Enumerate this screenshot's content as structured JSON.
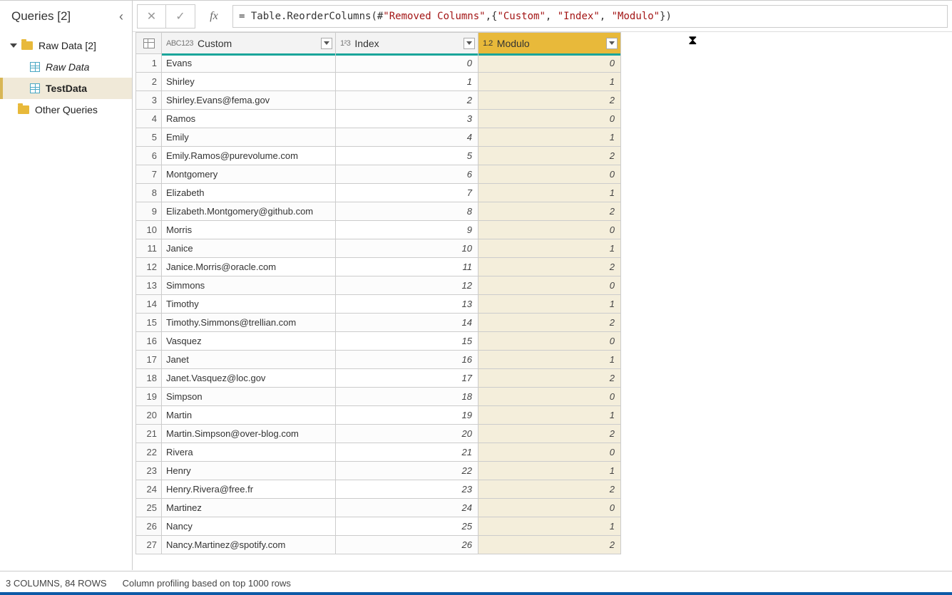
{
  "sidebar": {
    "title": "Queries [2]",
    "folders": [
      {
        "label": "Raw Data [2]",
        "expanded": true,
        "items": [
          {
            "label": "Raw Data",
            "italic": true,
            "selected": false
          },
          {
            "label": "TestData",
            "italic": false,
            "selected": true
          }
        ]
      },
      {
        "label": "Other Queries",
        "expanded": false,
        "items": []
      }
    ]
  },
  "formula": {
    "prefix": "= ",
    "func": "Table.ReorderColumns",
    "open": "(#",
    "step": "\"Removed Columns\"",
    "comma1": ",{",
    "c1": "\"Custom\"",
    "sep1": ", ",
    "c2": "\"Index\"",
    "sep2": ", ",
    "c3": "\"Modulo\"",
    "close": "})"
  },
  "columns": [
    {
      "name": "Custom",
      "type": "ABC123",
      "selected": false,
      "kind": "text"
    },
    {
      "name": "Index",
      "type": "1²3",
      "selected": false,
      "kind": "num"
    },
    {
      "name": "Modulo",
      "type": "1.2",
      "selected": true,
      "kind": "num"
    }
  ],
  "rows": [
    {
      "n": 1,
      "custom": "Evans",
      "index": 0,
      "modulo": 0
    },
    {
      "n": 2,
      "custom": "Shirley",
      "index": 1,
      "modulo": 1
    },
    {
      "n": 3,
      "custom": "Shirley.Evans@fema.gov",
      "index": 2,
      "modulo": 2
    },
    {
      "n": 4,
      "custom": "Ramos",
      "index": 3,
      "modulo": 0
    },
    {
      "n": 5,
      "custom": "Emily",
      "index": 4,
      "modulo": 1
    },
    {
      "n": 6,
      "custom": "Emily.Ramos@purevolume.com",
      "index": 5,
      "modulo": 2
    },
    {
      "n": 7,
      "custom": "Montgomery",
      "index": 6,
      "modulo": 0
    },
    {
      "n": 8,
      "custom": "Elizabeth",
      "index": 7,
      "modulo": 1
    },
    {
      "n": 9,
      "custom": "Elizabeth.Montgomery@github.com",
      "index": 8,
      "modulo": 2
    },
    {
      "n": 10,
      "custom": "Morris",
      "index": 9,
      "modulo": 0
    },
    {
      "n": 11,
      "custom": "Janice",
      "index": 10,
      "modulo": 1
    },
    {
      "n": 12,
      "custom": "Janice.Morris@oracle.com",
      "index": 11,
      "modulo": 2
    },
    {
      "n": 13,
      "custom": "Simmons",
      "index": 12,
      "modulo": 0
    },
    {
      "n": 14,
      "custom": "Timothy",
      "index": 13,
      "modulo": 1
    },
    {
      "n": 15,
      "custom": "Timothy.Simmons@trellian.com",
      "index": 14,
      "modulo": 2
    },
    {
      "n": 16,
      "custom": "Vasquez",
      "index": 15,
      "modulo": 0
    },
    {
      "n": 17,
      "custom": "Janet",
      "index": 16,
      "modulo": 1
    },
    {
      "n": 18,
      "custom": "Janet.Vasquez@loc.gov",
      "index": 17,
      "modulo": 2
    },
    {
      "n": 19,
      "custom": "Simpson",
      "index": 18,
      "modulo": 0
    },
    {
      "n": 20,
      "custom": "Martin",
      "index": 19,
      "modulo": 1
    },
    {
      "n": 21,
      "custom": "Martin.Simpson@over-blog.com",
      "index": 20,
      "modulo": 2
    },
    {
      "n": 22,
      "custom": "Rivera",
      "index": 21,
      "modulo": 0
    },
    {
      "n": 23,
      "custom": "Henry",
      "index": 22,
      "modulo": 1
    },
    {
      "n": 24,
      "custom": "Henry.Rivera@free.fr",
      "index": 23,
      "modulo": 2
    },
    {
      "n": 25,
      "custom": "Martinez",
      "index": 24,
      "modulo": 0
    },
    {
      "n": 26,
      "custom": "Nancy",
      "index": 25,
      "modulo": 1
    },
    {
      "n": 27,
      "custom": "Nancy.Martinez@spotify.com",
      "index": 26,
      "modulo": 2
    }
  ],
  "status": {
    "cols_rows": "3 COLUMNS, 84 ROWS",
    "profiling": "Column profiling based on top 1000 rows"
  },
  "icons": {
    "cancel": "✕",
    "confirm": "✓",
    "fx": "fx",
    "collapse": "‹",
    "hourglass": "⧗"
  }
}
